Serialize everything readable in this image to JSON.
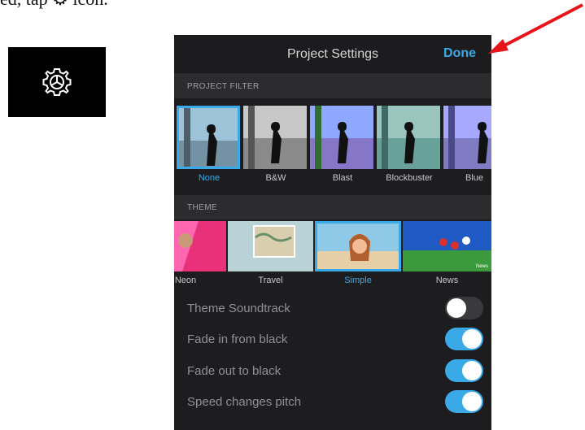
{
  "top_text": "ed, tap ⚙ icon.",
  "icons": {
    "gear": "gear-icon",
    "arrow": "red-arrow-icon"
  },
  "colors": {
    "accent": "#3aa9e8",
    "panel_bg": "#1d1d1f",
    "arrow": "#e8141c"
  },
  "nav": {
    "title": "Project Settings",
    "done_label": "Done"
  },
  "filters": {
    "header": "PROJECT FILTER",
    "items": [
      {
        "label": "None",
        "selected": true
      },
      {
        "label": "B&W",
        "selected": false
      },
      {
        "label": "Blast",
        "selected": false
      },
      {
        "label": "Blockbuster",
        "selected": false
      },
      {
        "label": "Blue",
        "selected": false
      }
    ]
  },
  "themes": {
    "header": "THEME",
    "items": [
      {
        "label": "Neon",
        "selected": false
      },
      {
        "label": "Travel",
        "selected": false
      },
      {
        "label": "Simple",
        "selected": true
      },
      {
        "label": "News",
        "selected": false,
        "badge": "News"
      }
    ]
  },
  "settings": [
    {
      "label": "Theme Soundtrack",
      "on": false
    },
    {
      "label": "Fade in from black",
      "on": true
    },
    {
      "label": "Fade out to black",
      "on": true
    },
    {
      "label": "Speed changes pitch",
      "on": true
    }
  ]
}
